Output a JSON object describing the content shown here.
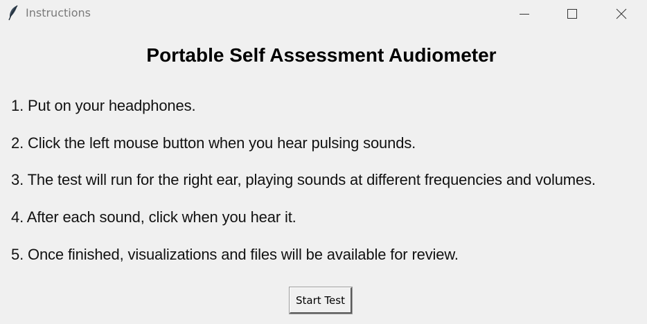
{
  "window": {
    "title": "Instructions",
    "icon": "feather-icon",
    "controls": {
      "minimize": "minimize-icon",
      "maximize": "maximize-icon",
      "close": "close-icon"
    }
  },
  "main": {
    "heading": "Portable Self Assessment Audiometer",
    "instructions": [
      "1. Put on your headphones.",
      "2. Click the left mouse button when you hear pulsing sounds.",
      "3. The test will run for the right ear, playing sounds at different frequencies and volumes.",
      "4. After each sound, click when you hear it.",
      "5. Once finished, visualizations and files will be available for review."
    ],
    "start_button_label": "Start Test"
  },
  "colors": {
    "background": "#f0f0f0",
    "title_text": "#7a7a7a",
    "heading_text": "#000000",
    "body_text": "#111111"
  }
}
